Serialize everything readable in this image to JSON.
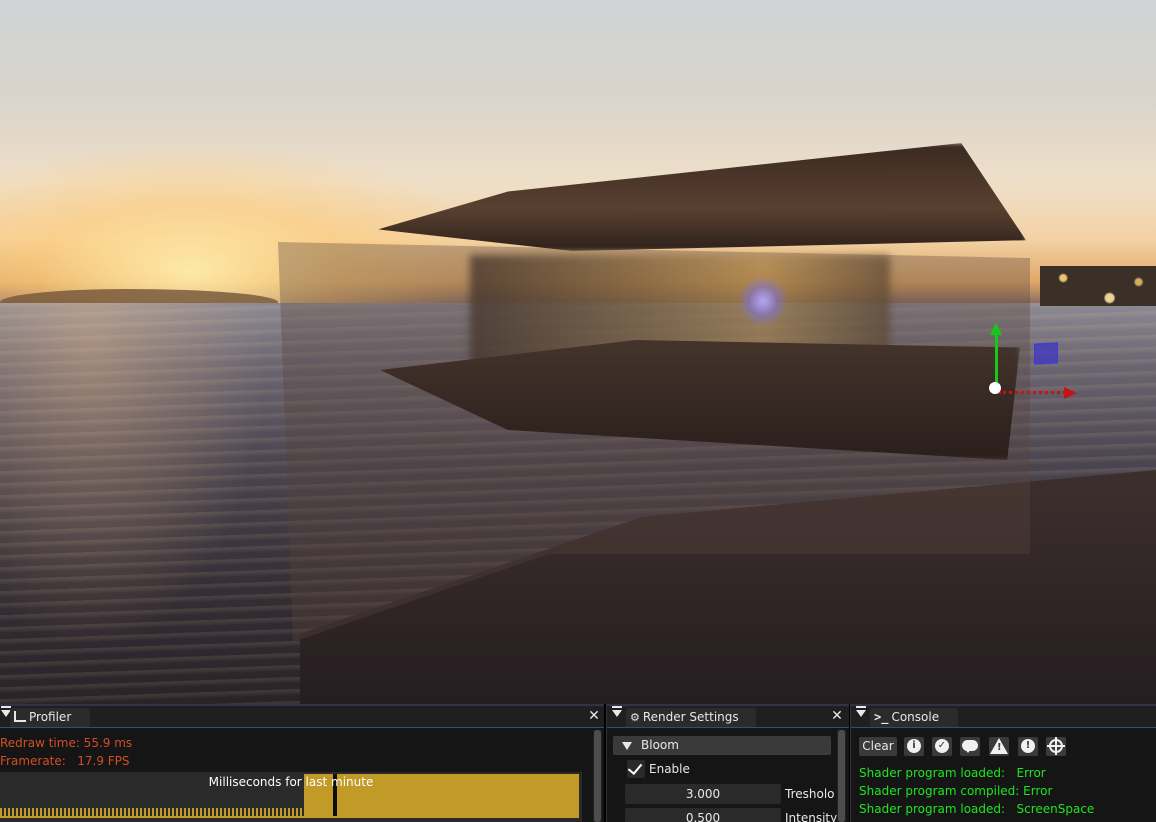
{
  "viewport": {
    "gizmo": {
      "y_axis_color": "#17c817",
      "x_axis_color": "#c41414",
      "plane_handle_color": "#3c32c8"
    }
  },
  "profiler": {
    "tab_label": "Profiler",
    "tab_icon": "bar-chart-icon",
    "redraw_time": "Redraw time: 55.9 ms",
    "framerate": "Framerate:   17.9 FPS",
    "plot_title": "Milliseconds for last minute",
    "plot_color": "#c29a27",
    "text_color": "#d04e26"
  },
  "render_settings": {
    "tab_label": "Render Settings",
    "tab_icon": "gear-icon",
    "section": "Bloom",
    "enable_label": "Enable",
    "enable_checked": true,
    "threshold_value": "3.000",
    "threshold_label": "Tresholo",
    "intensity_value": "0.500",
    "intensity_label": "Intensity"
  },
  "console": {
    "tab_label": "Console",
    "tab_icon": "terminal-icon",
    "clear_label": "Clear",
    "toolbar_icons": [
      "info-icon",
      "check-icon",
      "message-icon",
      "warning-icon",
      "error-icon",
      "target-icon"
    ],
    "lines": [
      "Shader program loaded:   Error",
      "Shader program compiled: Error",
      "Shader program loaded:   ScreenSpace"
    ],
    "text_color": "#1ee61e"
  }
}
